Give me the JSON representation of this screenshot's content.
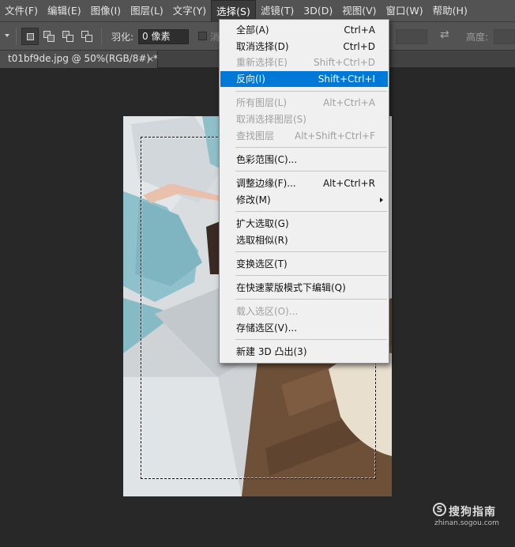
{
  "menubar": {
    "items": [
      "文件(F)",
      "编辑(E)",
      "图像(I)",
      "图层(L)",
      "文字(Y)",
      "选择(S)",
      "滤镜(T)",
      "3D(D)",
      "视图(V)",
      "窗口(W)",
      "帮助(H)"
    ],
    "active_index": 5
  },
  "options": {
    "feather_label": "羽化:",
    "feather_value": "0 像素",
    "antialias_label": "消",
    "height_label": "高度:"
  },
  "tab": {
    "title": "t01bf9de.jpg @ 50%(RGB/8#) *",
    "close": "×"
  },
  "select_menu": {
    "items": [
      {
        "label": "全部(A)",
        "shortcut": "Ctrl+A",
        "state": "enabled"
      },
      {
        "label": "取消选择(D)",
        "shortcut": "Ctrl+D",
        "state": "enabled"
      },
      {
        "label": "重新选择(E)",
        "shortcut": "Shift+Ctrl+D",
        "state": "disabled"
      },
      {
        "label": "反向(I)",
        "shortcut": "Shift+Ctrl+I",
        "state": "highlighted"
      },
      {
        "label": "所有图层(L)",
        "shortcut": "Alt+Ctrl+A",
        "state": "disabled"
      },
      {
        "label": "取消选择图层(S)",
        "shortcut": "",
        "state": "disabled"
      },
      {
        "label": "查找图层",
        "shortcut": "Alt+Shift+Ctrl+F",
        "state": "disabled"
      },
      {
        "label": "色彩范围(C)...",
        "shortcut": "",
        "state": "enabled"
      },
      {
        "label": "调整边缘(F)...",
        "shortcut": "Alt+Ctrl+R",
        "state": "enabled"
      },
      {
        "label": "修改(M)",
        "shortcut": "",
        "state": "enabled",
        "submenu": true
      },
      {
        "label": "扩大选取(G)",
        "shortcut": "",
        "state": "enabled"
      },
      {
        "label": "选取相似(R)",
        "shortcut": "",
        "state": "enabled"
      },
      {
        "label": "变换选区(T)",
        "shortcut": "",
        "state": "enabled"
      },
      {
        "label": "在快速蒙版模式下编辑(Q)",
        "shortcut": "",
        "state": "enabled"
      },
      {
        "label": "载入选区(O)...",
        "shortcut": "",
        "state": "disabled"
      },
      {
        "label": "存储选区(V)...",
        "shortcut": "",
        "state": "enabled"
      },
      {
        "label": "新建 3D 凸出(3)",
        "shortcut": "",
        "state": "enabled"
      }
    ]
  },
  "watermark": {
    "logo_glyph": "S",
    "brand": "搜狗指南",
    "url": "zhinan.sogou.com"
  },
  "colors": {
    "highlight": "#0078d7",
    "ui_dark": "#535353",
    "workspace": "#282828"
  }
}
